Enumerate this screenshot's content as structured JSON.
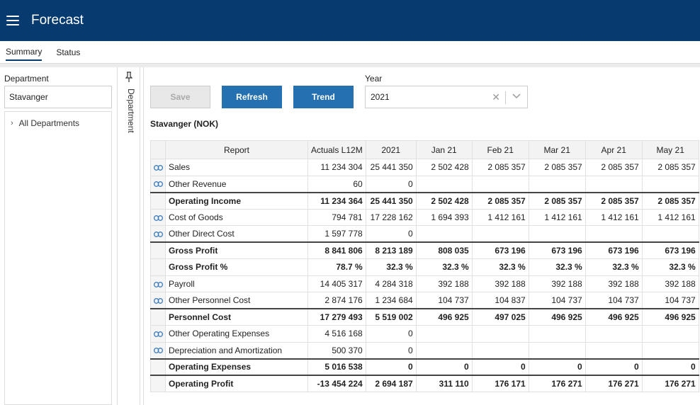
{
  "app": {
    "title": "Forecast"
  },
  "tabs": [
    {
      "label": "Summary"
    },
    {
      "label": "Status"
    }
  ],
  "left": {
    "dept_label": "Department",
    "dept_value": "Stavanger",
    "tree_item": "All Departments"
  },
  "side_tab": {
    "label": "Department"
  },
  "toolbar": {
    "save": "Save",
    "refresh": "Refresh",
    "trend": "Trend",
    "year_label": "Year",
    "year_value": "2021"
  },
  "report": {
    "title": "Stavanger (NOK)",
    "headers": [
      "Report",
      "Actuals L12M",
      "2021",
      "Jan 21",
      "Feb 21",
      "Mar 21",
      "Apr 21",
      "May 21"
    ],
    "rows": [
      {
        "name": "Sales",
        "link": true,
        "bold": false,
        "line": false,
        "values": [
          "11 234 304",
          "25 441 350",
          "2 502 428",
          "2 085 357",
          "2 085 357",
          "2 085 357",
          "2 085 357"
        ]
      },
      {
        "name": "Other Revenue",
        "link": true,
        "bold": false,
        "line": false,
        "values": [
          "60",
          "0",
          "",
          "",
          "",
          "",
          ""
        ]
      },
      {
        "name": "Operating Income",
        "link": false,
        "bold": true,
        "line": true,
        "values": [
          "11 234 364",
          "25 441 350",
          "2 502 428",
          "2 085 357",
          "2 085 357",
          "2 085 357",
          "2 085 357"
        ]
      },
      {
        "name": "Cost of Goods",
        "link": true,
        "bold": false,
        "line": false,
        "values": [
          "794 781",
          "17 228 162",
          "1 694 393",
          "1 412 161",
          "1 412 161",
          "1 412 161",
          "1 412 161"
        ]
      },
      {
        "name": "Other Direct Cost",
        "link": true,
        "bold": false,
        "line": false,
        "values": [
          "1 597 778",
          "0",
          "",
          "",
          "",
          "",
          ""
        ]
      },
      {
        "name": "Gross Profit",
        "link": false,
        "bold": true,
        "line": true,
        "values": [
          "8 841 806",
          "8 213 189",
          "808 035",
          "673 196",
          "673 196",
          "673 196",
          "673 196"
        ]
      },
      {
        "name": "Gross Profit %",
        "link": false,
        "bold": true,
        "line": false,
        "values": [
          "78.7 %",
          "32.3 %",
          "32.3 %",
          "32.3 %",
          "32.3 %",
          "32.3 %",
          "32.3 %"
        ]
      },
      {
        "name": "Payroll",
        "link": true,
        "bold": false,
        "line": false,
        "values": [
          "14 405 317",
          "4 284 318",
          "392 188",
          "392 188",
          "392 188",
          "392 188",
          "392 188"
        ]
      },
      {
        "name": "Other Personnel Cost",
        "link": true,
        "bold": false,
        "line": false,
        "values": [
          "2 874 176",
          "1 234 684",
          "104 737",
          "104 837",
          "104 737",
          "104 737",
          "104 737"
        ]
      },
      {
        "name": "Personnel Cost",
        "link": false,
        "bold": true,
        "line": true,
        "values": [
          "17 279 493",
          "5 519 002",
          "496 925",
          "497 025",
          "496 925",
          "496 925",
          "496 925"
        ]
      },
      {
        "name": "Other Operating Expenses",
        "link": true,
        "bold": false,
        "line": false,
        "values": [
          "4 516 168",
          "0",
          "",
          "",
          "",
          "",
          ""
        ]
      },
      {
        "name": "Depreciation and Amortization",
        "link": true,
        "bold": false,
        "line": false,
        "values": [
          "500 370",
          "0",
          "",
          "",
          "",
          "",
          ""
        ]
      },
      {
        "name": "Operating Expenses",
        "link": false,
        "bold": true,
        "line": true,
        "values": [
          "5 016 538",
          "0",
          "0",
          "0",
          "0",
          "0",
          "0"
        ]
      },
      {
        "name": "Operating Profit",
        "link": false,
        "bold": true,
        "line": true,
        "values": [
          "-13 454 224",
          "2 694 187",
          "311 110",
          "176 171",
          "176 271",
          "176 271",
          "176 271"
        ]
      }
    ]
  },
  "colors": {
    "topbar": "#073b70",
    "primary_button": "#2470b1"
  }
}
